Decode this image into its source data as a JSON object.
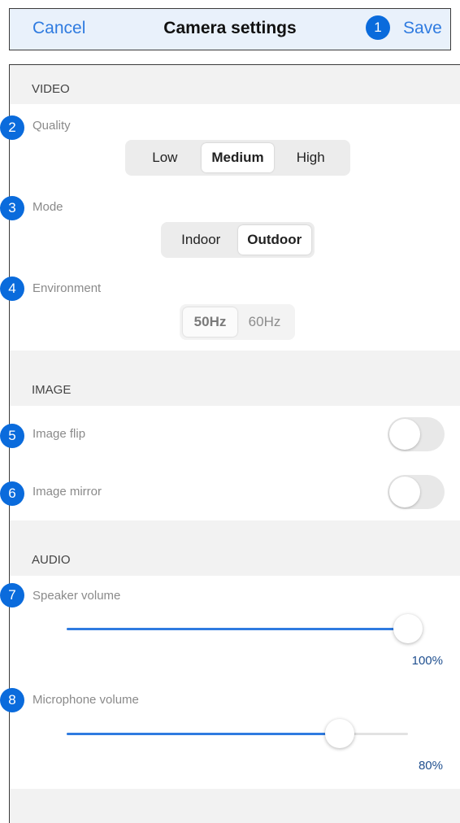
{
  "header": {
    "cancel_label": "Cancel",
    "title": "Camera settings",
    "save_label": "Save"
  },
  "badges": [
    "1",
    "2",
    "3",
    "4",
    "5",
    "6",
    "7",
    "8"
  ],
  "video": {
    "header": "VIDEO",
    "quality": {
      "label": "Quality",
      "options": [
        "Low",
        "Medium",
        "High"
      ],
      "selected": "Medium"
    },
    "mode": {
      "label": "Mode",
      "options": [
        "Indoor",
        "Outdoor"
      ],
      "selected": "Outdoor"
    },
    "environment": {
      "label": "Environment",
      "options": [
        "50Hz",
        "60Hz"
      ],
      "selected": "50Hz",
      "disabled": true
    }
  },
  "image": {
    "header": "IMAGE",
    "flip": {
      "label": "Image flip",
      "on": false
    },
    "mirror": {
      "label": "Image mirror",
      "on": false
    }
  },
  "audio": {
    "header": "AUDIO",
    "speaker": {
      "label": "Speaker volume",
      "value": 100,
      "value_text": "100%"
    },
    "microphone": {
      "label": "Microphone volume",
      "value": 80,
      "value_text": "80%"
    }
  },
  "colors": {
    "accent": "#2f7be0",
    "badge": "#0a6bdc",
    "header_bg": "#e9f1fb"
  }
}
